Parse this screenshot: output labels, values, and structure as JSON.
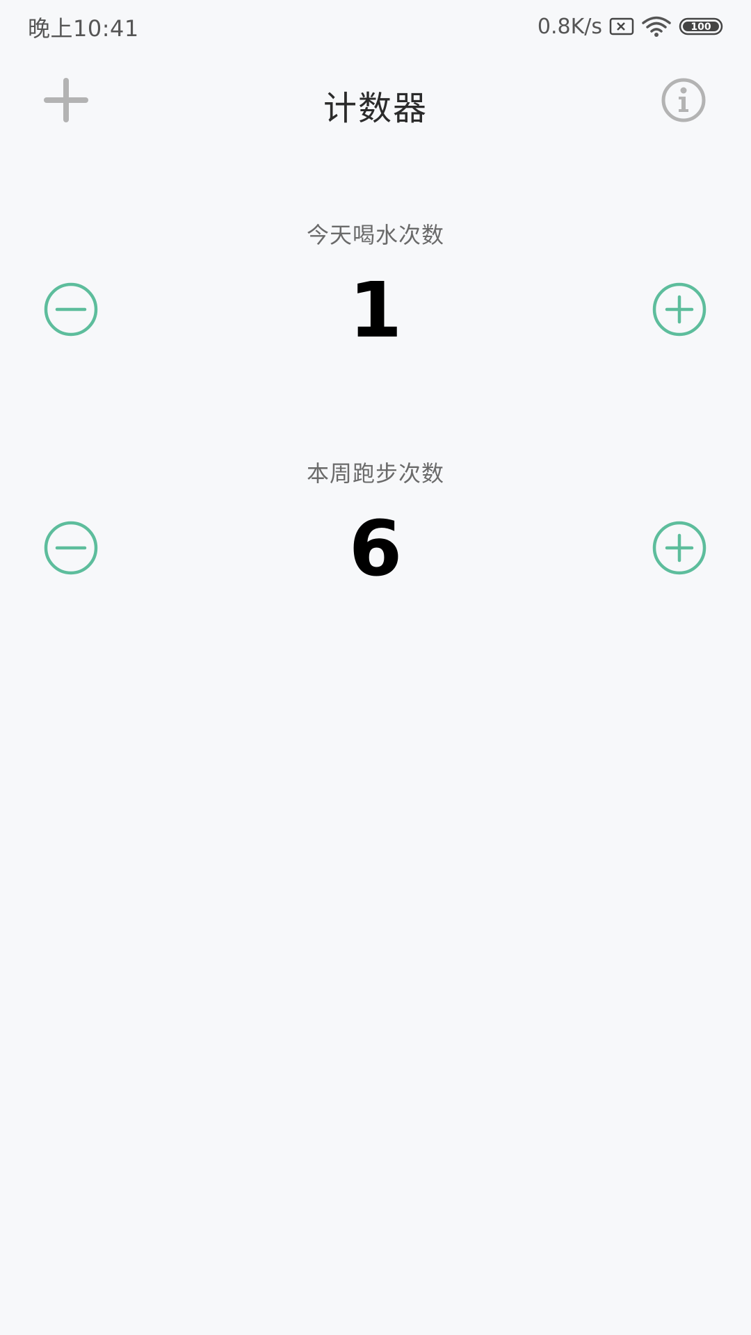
{
  "status_bar": {
    "time": "晚上10:41",
    "net_speed": "0.8K/s",
    "battery": "100"
  },
  "app_bar": {
    "title": "计数器",
    "add_icon": "plus-icon",
    "info_icon": "info-icon"
  },
  "counters": [
    {
      "label": "今天喝水次数",
      "value": "1"
    },
    {
      "label": "本周跑步次数",
      "value": "6"
    }
  ],
  "colors": {
    "accent": "#5dbd9c",
    "background": "#f7f8fa",
    "toolbar_icon": "#b3b3b3",
    "label_text": "#6a6a6a"
  }
}
